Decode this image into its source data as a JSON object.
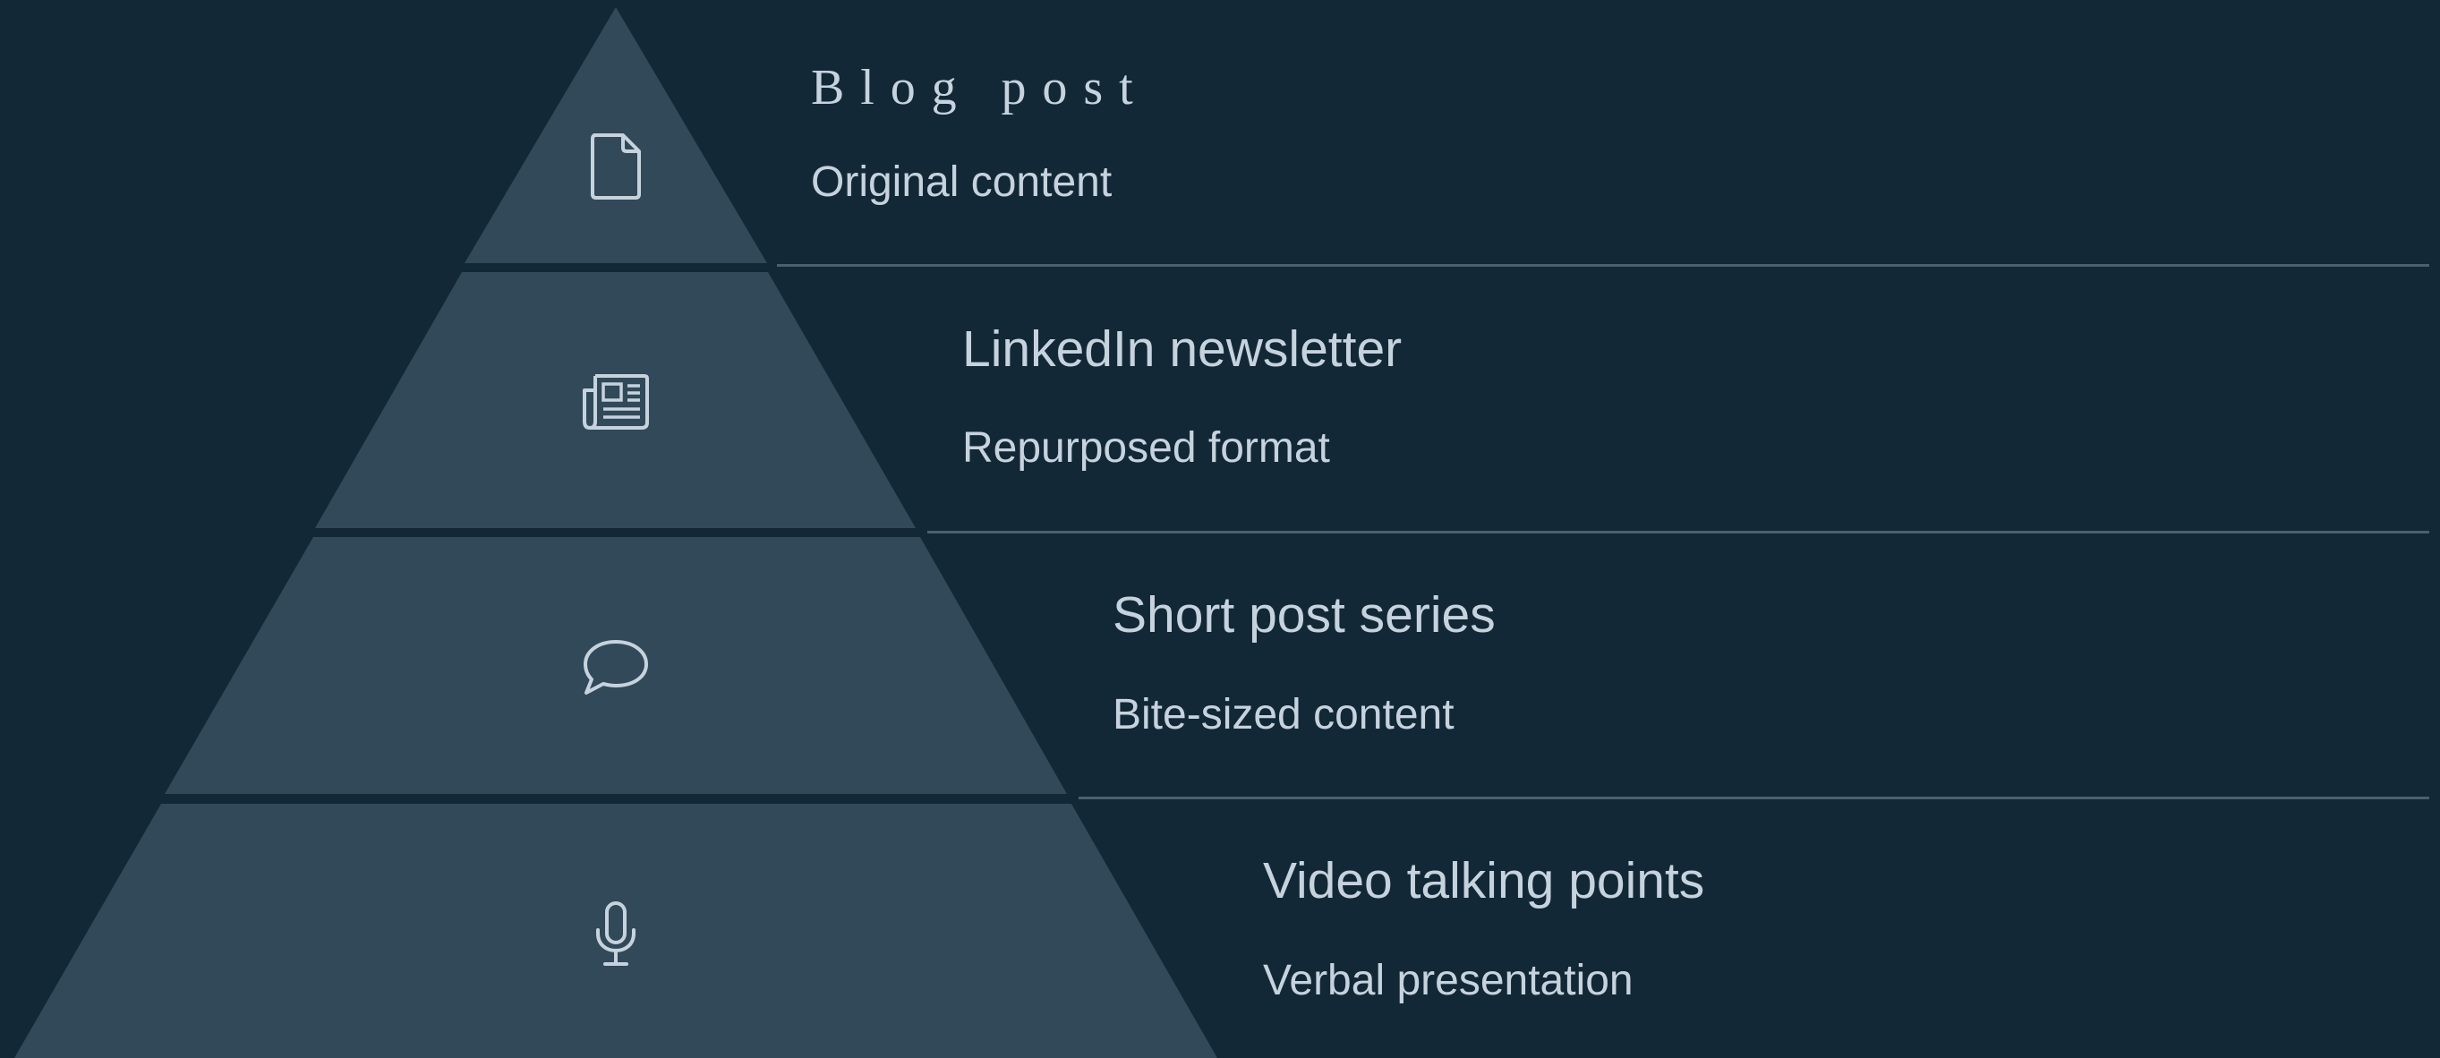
{
  "colors": {
    "background": "#132836",
    "tier_fill": "#314958",
    "text": "#c6d3de",
    "icon_stroke": "#c6d3de",
    "divider": "#4a6070"
  },
  "tiers": [
    {
      "title": "Blog post",
      "subtitle": "Original content",
      "icon": "document-icon"
    },
    {
      "title": "LinkedIn newsletter",
      "subtitle": "Repurposed format",
      "icon": "newspaper-icon"
    },
    {
      "title": "Short post series",
      "subtitle": "Bite-sized content",
      "icon": "speech-bubble-icon"
    },
    {
      "title": "Video talking points",
      "subtitle": "Verbal presentation",
      "icon": "microphone-icon"
    }
  ]
}
